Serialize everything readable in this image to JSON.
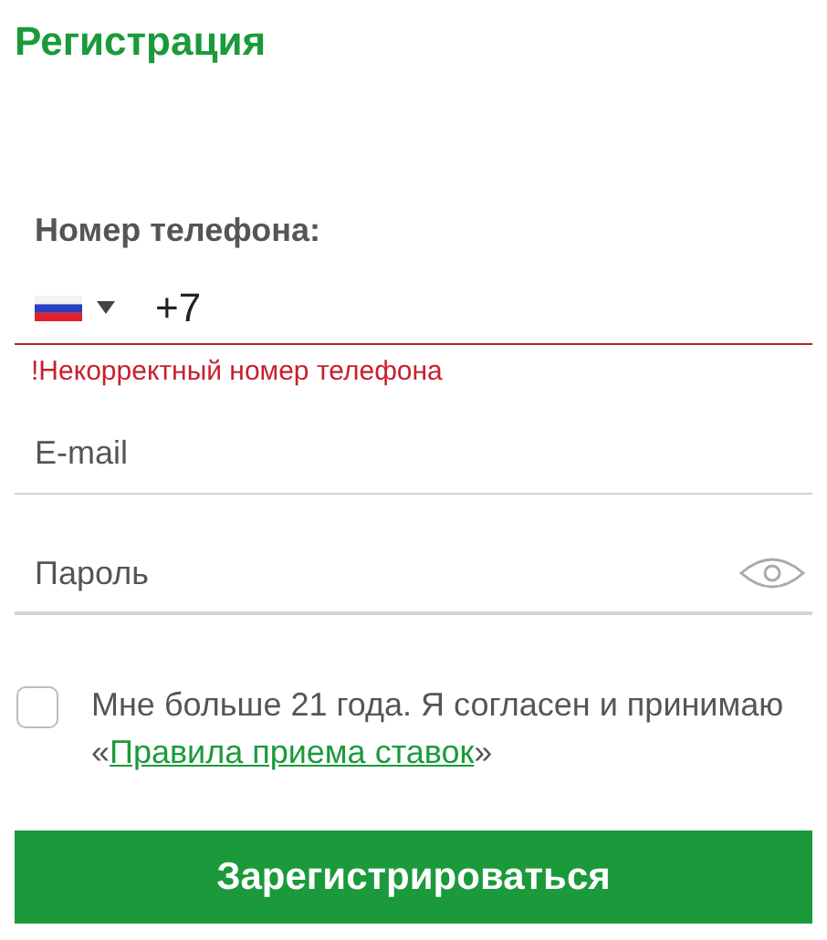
{
  "title": "Регистрация",
  "phone": {
    "label": "Номер телефона:",
    "value": "+7",
    "invalid": true,
    "error": "!Некорректный номер телефона"
  },
  "email": {
    "placeholder": "E-mail"
  },
  "password": {
    "placeholder": "Пароль"
  },
  "agreement": {
    "checked": false,
    "text_before": "Мне больше 21 года. Я согласен и принимаю «",
    "link": "Правила приема ставок",
    "text_after": "»"
  },
  "submit": "Зарегистрироваться"
}
